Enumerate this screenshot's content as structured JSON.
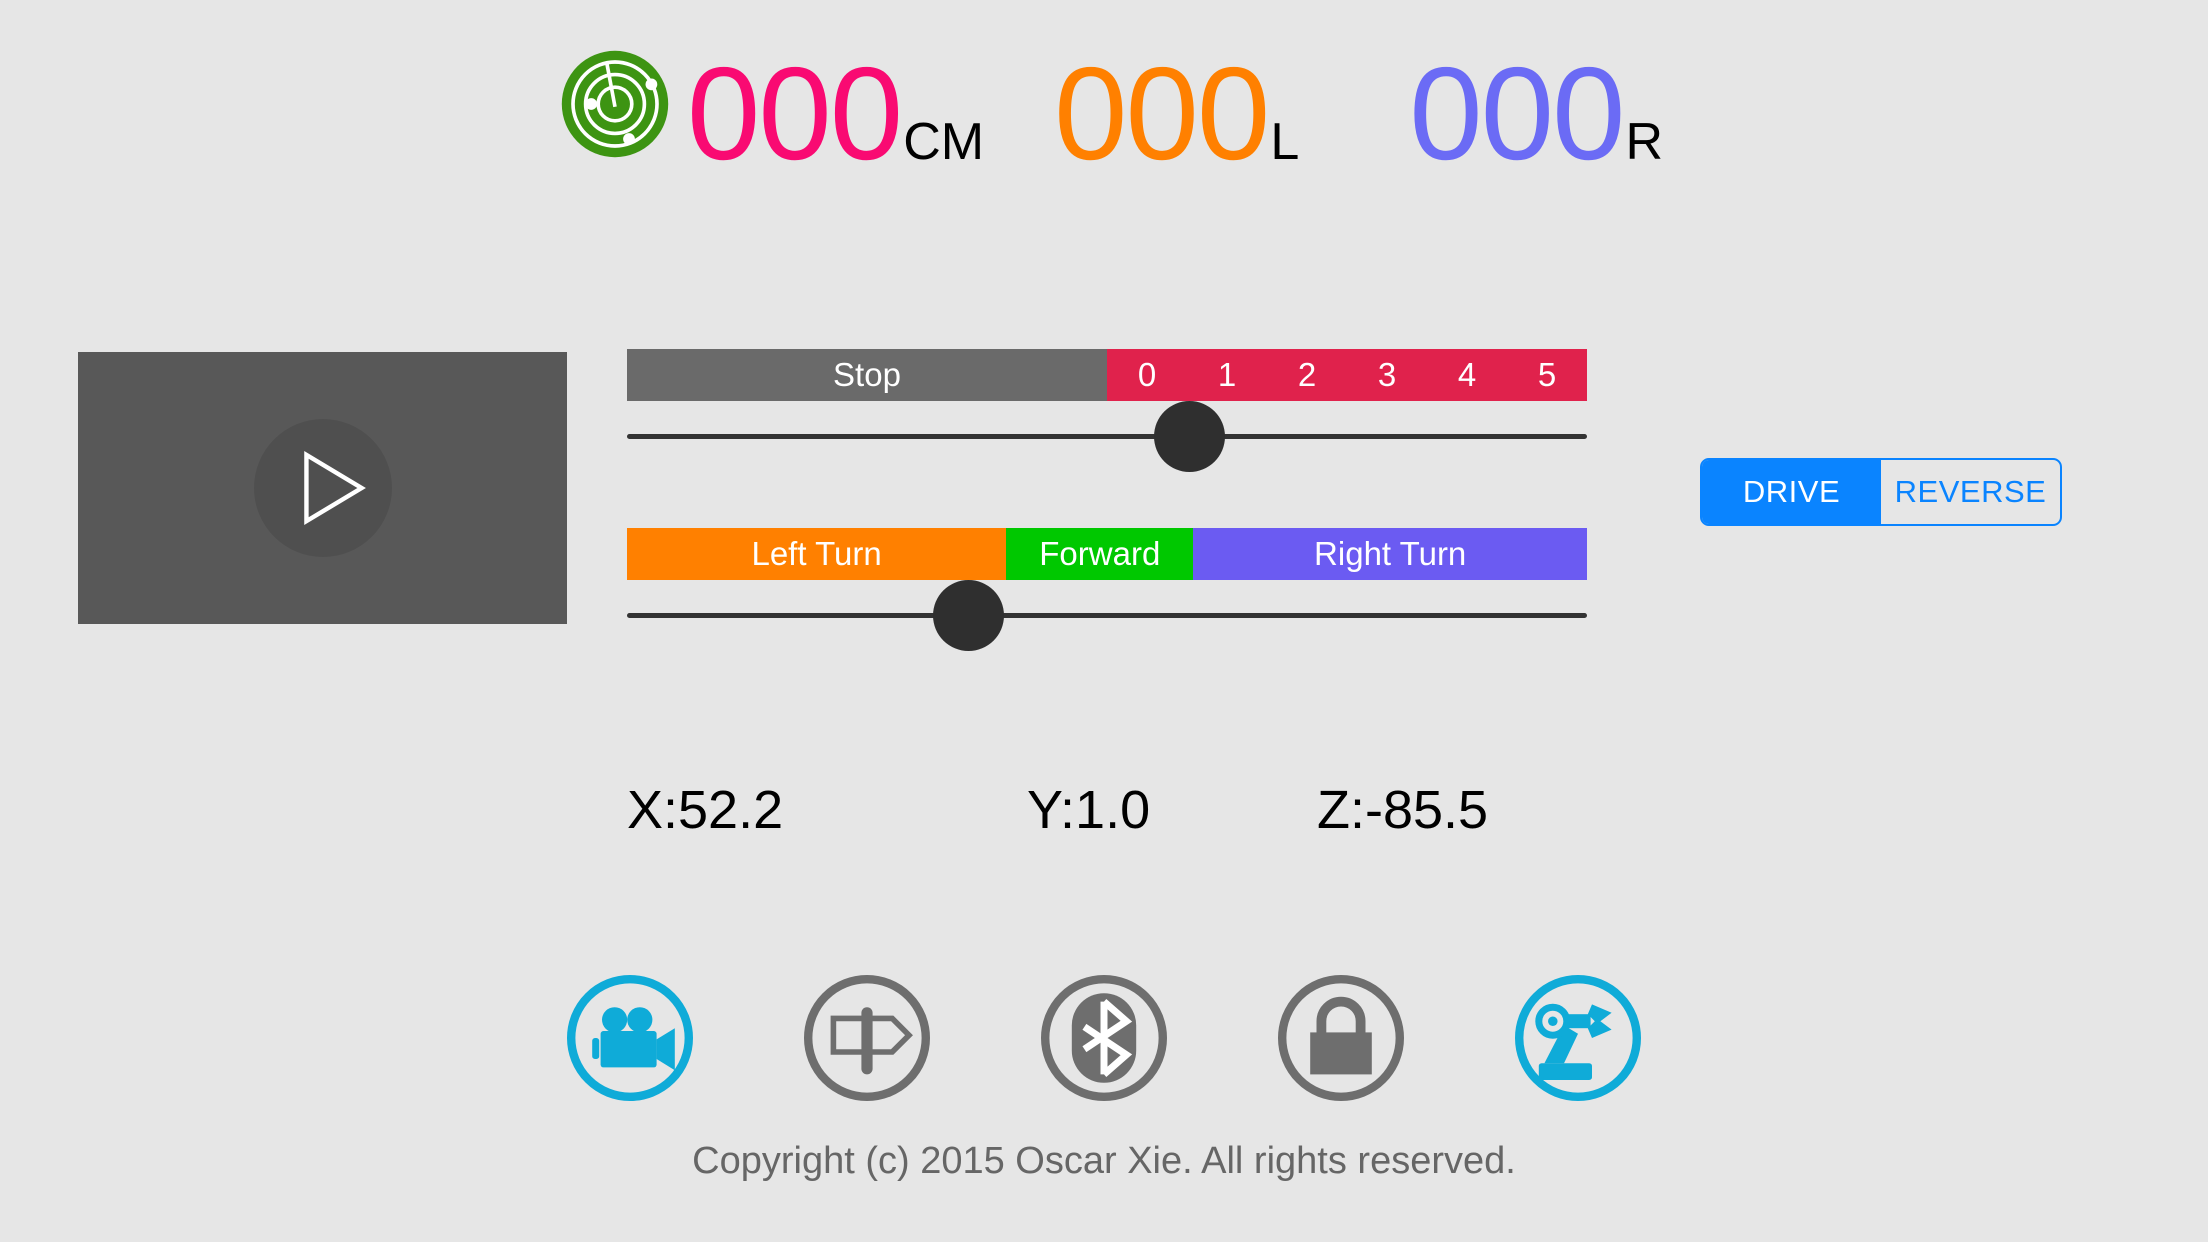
{
  "app": {
    "background_color": "#e6e6e6",
    "copyright": "Copyright (c) 2015 Oscar Xie. All rights reserved."
  },
  "readouts": {
    "radar_icon": "radar-icon",
    "radar_color": "#3d9412",
    "distance": {
      "digits": "000",
      "unit": "CM",
      "color": "#f90a72"
    },
    "left": {
      "digits": "000",
      "unit": "L",
      "color": "#ff8000"
    },
    "right": {
      "digits": "000",
      "unit": "R",
      "color": "#6b6bf5"
    }
  },
  "video": {
    "play_icon": "play-icon",
    "panel_color": "#585858"
  },
  "speed_slider": {
    "stop_label": "Stop",
    "ticks": [
      "0",
      "1",
      "2",
      "3",
      "4",
      "5"
    ],
    "stop_color": "#6a6a6a",
    "speed_color": "#e0224c",
    "thumb_position_percent": 58.5,
    "stop_width_percent": 50
  },
  "direction_slider": {
    "segments": [
      {
        "label": "Left Turn",
        "color": "#ff8000",
        "width_percent": 39.5
      },
      {
        "label": "Forward",
        "color": "#00c800",
        "width_percent": 19.5
      },
      {
        "label": "Right Turn",
        "color": "#6b5bf2",
        "width_percent": 41.0
      }
    ],
    "thumb_position_percent": 35.5
  },
  "drive_toggle": {
    "accent_color": "#0a84ff",
    "options": [
      {
        "label": "DRIVE",
        "selected": true
      },
      {
        "label": "REVERSE",
        "selected": false
      }
    ]
  },
  "orientation": {
    "x": "X:52.2",
    "y": "Y:1.0",
    "z": "Z:-85.5"
  },
  "toolbar": {
    "active_color": "#0fabd8",
    "inactive_color": "#6e6e6e",
    "items": [
      {
        "name": "camera-icon",
        "label": "Camera",
        "active": true
      },
      {
        "name": "signpost-icon",
        "label": "Signpost",
        "active": false
      },
      {
        "name": "bluetooth-icon",
        "label": "Bluetooth",
        "active": false
      },
      {
        "name": "lock-icon",
        "label": "Lock",
        "active": false
      },
      {
        "name": "robot-arm-icon",
        "label": "Robot Arm",
        "active": true
      }
    ]
  }
}
